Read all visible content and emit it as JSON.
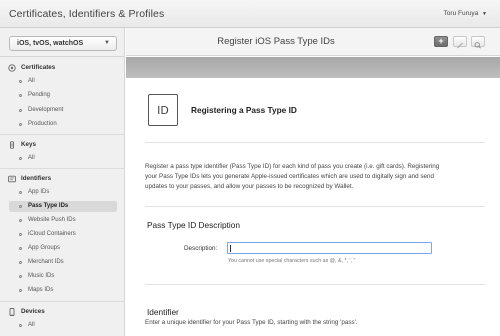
{
  "header": {
    "app_title": "Certificates, Identifiers & Profiles",
    "user_name": "Toru Furuya",
    "user_caret": "▼"
  },
  "sidebar": {
    "platform_select": "iOS, tvOS, watchOS",
    "platform_chevron": "▼",
    "groups": [
      {
        "label": "Certificates",
        "icon": "certificate-icon",
        "items": [
          "All",
          "Pending",
          "Development",
          "Production"
        ]
      },
      {
        "label": "Keys",
        "icon": "key-icon",
        "items": [
          "All"
        ]
      },
      {
        "label": "Identifiers",
        "icon": "identifier-icon",
        "items": [
          "App IDs",
          "Pass Type IDs",
          "Website Push IDs",
          "iCloud Containers",
          "App Groups",
          "Merchant IDs",
          "Music IDs",
          "Maps IDs"
        ]
      },
      {
        "label": "Devices",
        "icon": "device-icon",
        "items": [
          "All"
        ]
      }
    ],
    "selected_item": "Pass Type IDs"
  },
  "main": {
    "page_title": "Register iOS Pass Type IDs",
    "add_button_label": "+",
    "icon_label": "ID",
    "section_heading": "Registering a Pass Type ID",
    "intro_text": "Register a pass type identifier (Pass Type ID) for each kind of pass you create (i.e. gift cards). Registering your Pass Type IDs lets you generate Apple-issued certificates which are used to digitally sign and send updates to your passes, and allow your passes to be recognized by Wallet.",
    "description_section": {
      "heading": "Pass Type ID Description",
      "field_label": "Description:",
      "field_value": "",
      "hint": "You cannot use special characters such as @, &, *, ', \""
    },
    "identifier_section": {
      "heading": "Identifier",
      "description": "Enter a unique identifier for your Pass Type ID, starting with the string 'pass'."
    }
  },
  "colors": {
    "input_focus_border": "#7aa7ea",
    "selected_nav_bg": "#d9d9d9",
    "gray_band": "#b0b0b0"
  }
}
